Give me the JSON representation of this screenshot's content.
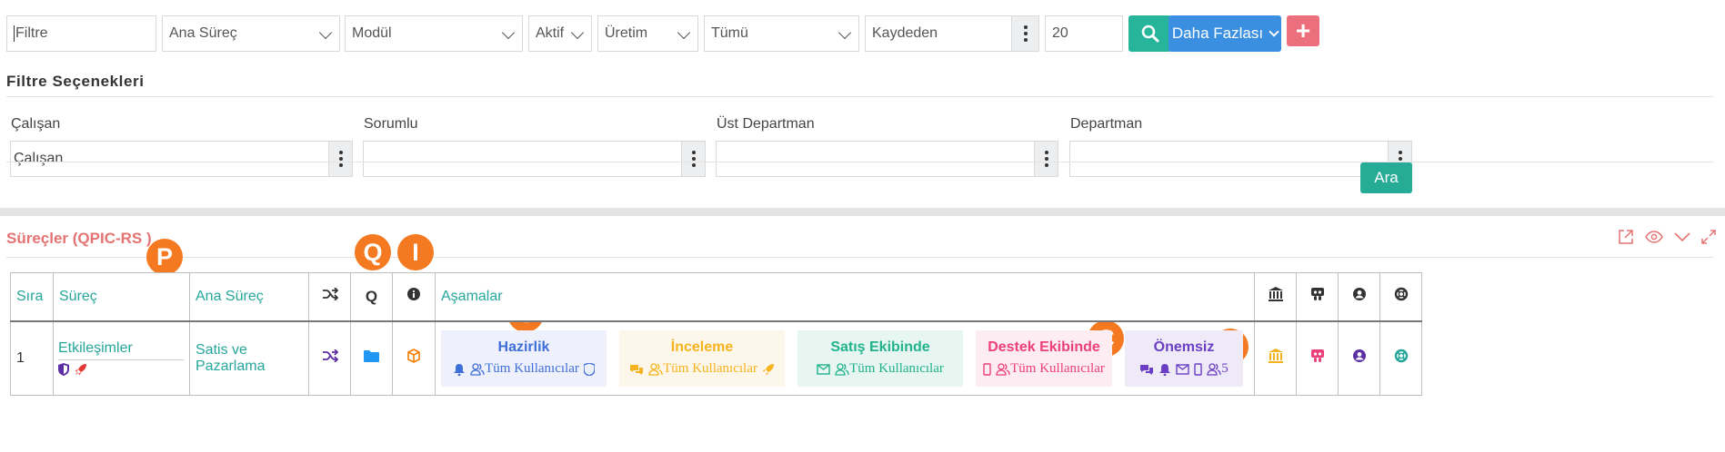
{
  "toolbar": {
    "filter_placeholder": "Filtre",
    "ana_surec": "Ana Süreç",
    "modul": "Modül",
    "aktif": "Aktif",
    "uretim": "Üretim",
    "tumu": "Tümü",
    "kaydeden": "Kaydeden",
    "page_size": "20",
    "more_label": "Daha Fazlası",
    "add_label": "+"
  },
  "filter_options": {
    "title": "Filtre Seçenekleri",
    "fields": [
      {
        "label": "Çalışan",
        "value": "Çalışan"
      },
      {
        "label": "Sorumlu",
        "value": ""
      },
      {
        "label": "Üst Departman",
        "value": ""
      },
      {
        "label": "Departman",
        "value": ""
      }
    ],
    "search_label": "Ara"
  },
  "panel": {
    "title": "Süreçler (QPIC-RS )"
  },
  "badges": [
    "P",
    "Q",
    "I",
    "S",
    "C",
    "R"
  ],
  "table": {
    "headers": {
      "sira": "Sıra",
      "surec": "Süreç",
      "ana_surec": "Ana Süreç",
      "asamalar": "Aşamalar"
    },
    "rows": [
      {
        "sira": "1",
        "surec": "Etkileşimler",
        "ana_surec": "Satis ve Pazarlama",
        "stages": [
          {
            "name": "Hazirlik",
            "users": "Tüm Kullanıcılar",
            "color": "#3f6fd8",
            "bg": "#eef0fb"
          },
          {
            "name": "İnceleme",
            "users": "Tüm Kullanıcılar",
            "color": "#f5b41e",
            "bg": "#fdf6ea"
          },
          {
            "name": "Satış Ekibinde",
            "users": "Tüm Kullanıcılar",
            "color": "#22b28c",
            "bg": "#e7f6f1"
          },
          {
            "name": "Destek Ekibinde",
            "users": "Tüm Kullanıcılar",
            "color": "#ec407a",
            "bg": "#fdecf1"
          },
          {
            "name": "Önemsiz",
            "users": "5",
            "color": "#6a3fc4",
            "bg": "#efeaf8"
          }
        ]
      }
    ]
  },
  "colors": {
    "teal": "#26b59a",
    "blue": "#3a8fe0",
    "pink": "#ec6f7d",
    "badge": "#f47920",
    "panel_title": "#e57373"
  }
}
